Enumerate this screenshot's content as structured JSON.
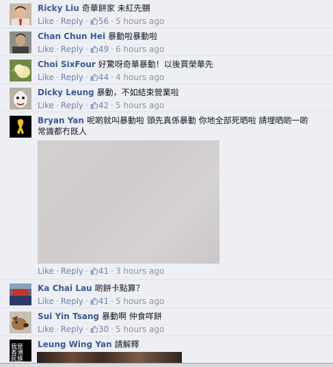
{
  "labels": {
    "like": "Like",
    "reply": "Reply",
    "dot": "·"
  },
  "comments": [
    {
      "author": "Ricky Liu",
      "text": "奇華餅家 未紅先嬲",
      "likes": "56",
      "time": "5 hours ago",
      "avatar": "avatar-boy-red-tie"
    },
    {
      "author": "Chan Chun Hei",
      "text": "暴動啦暴動啦",
      "likes": "49",
      "time": "6 hours ago",
      "avatar": "avatar-man-portrait"
    },
    {
      "author": "Choi SixFour",
      "text": "好驚呀奇華暴動！以後買榮華先",
      "likes": "44",
      "time": "4 hours ago",
      "avatar": "avatar-yellow-chick"
    },
    {
      "author": "Dicky Leung",
      "text": "暴動，不如結束營業啦",
      "likes": "42",
      "time": "5 hours ago",
      "avatar": "avatar-clown-face"
    },
    {
      "author": "Bryan Yan",
      "text": "呢啲就叫暴動啦 頭先真係暴動 你地全部死晒啦 請埋晒啲一啲常識都冇既人",
      "likes": "41",
      "time": "3 hours ago",
      "avatar": "yellow-ribbon-icon"
    },
    {
      "author": "Ka Chai Lau",
      "text": "啲餅卡點算？",
      "likes": "41",
      "time": "5 hours ago",
      "avatar": "avatar-street-scene"
    },
    {
      "author": "Sui Yin Tsang",
      "text": "暴動啊 仲食咩餅",
      "likes": "30",
      "time": "5 hours ago",
      "avatar": "avatar-dog"
    },
    {
      "author": "Leung Wing Yan",
      "text": "請解釋",
      "avatar": "avatar-calligraphy",
      "avatar_text": "我是香港民族"
    }
  ],
  "colors": {
    "author": "#3b5998",
    "link": "#6d84b4",
    "meta": "#90949c",
    "bg": "#edeff4"
  }
}
